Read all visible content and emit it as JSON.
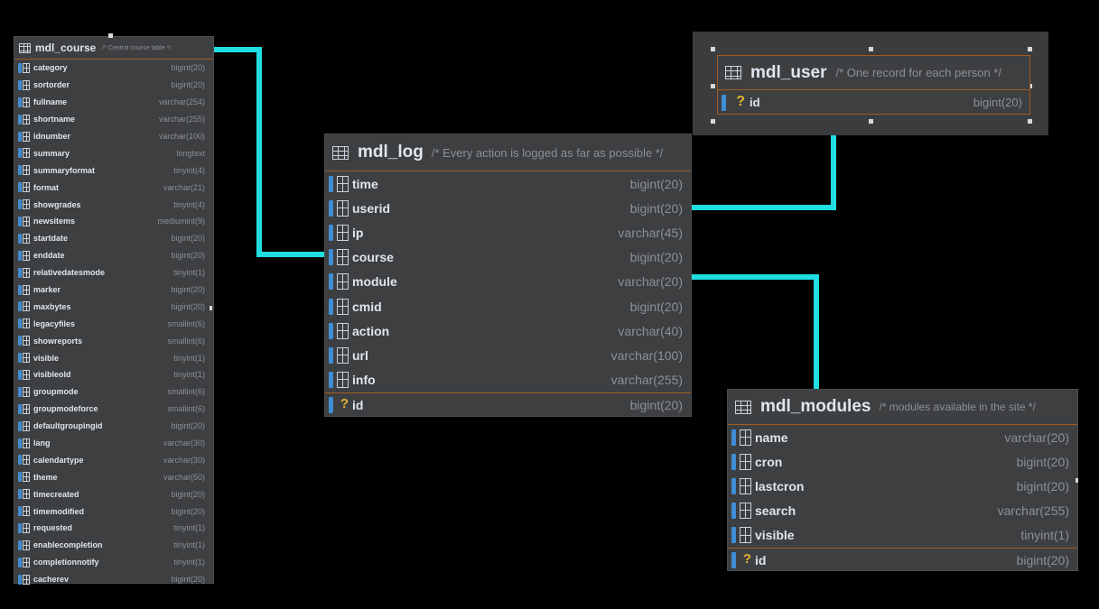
{
  "tables": {
    "course": {
      "name": "mdl_course",
      "comment": "/* Central course table */",
      "columns": [
        {
          "name": "category",
          "type": "bigint(20)"
        },
        {
          "name": "sortorder",
          "type": "bigint(20)"
        },
        {
          "name": "fullname",
          "type": "varchar(254)"
        },
        {
          "name": "shortname",
          "type": "varchar(255)"
        },
        {
          "name": "idnumber",
          "type": "varchar(100)"
        },
        {
          "name": "summary",
          "type": "longtext"
        },
        {
          "name": "summaryformat",
          "type": "tinyint(4)"
        },
        {
          "name": "format",
          "type": "varchar(21)"
        },
        {
          "name": "showgrades",
          "type": "tinyint(4)"
        },
        {
          "name": "newsitems",
          "type": "mediumint(9)"
        },
        {
          "name": "startdate",
          "type": "bigint(20)"
        },
        {
          "name": "enddate",
          "type": "bigint(20)"
        },
        {
          "name": "relativedatesmode",
          "type": "tinyint(1)"
        },
        {
          "name": "marker",
          "type": "bigint(20)"
        },
        {
          "name": "maxbytes",
          "type": "bigint(20)"
        },
        {
          "name": "legacyfiles",
          "type": "smallint(6)"
        },
        {
          "name": "showreports",
          "type": "smallint(6)"
        },
        {
          "name": "visible",
          "type": "tinyint(1)"
        },
        {
          "name": "visibleold",
          "type": "tinyint(1)"
        },
        {
          "name": "groupmode",
          "type": "smallint(6)"
        },
        {
          "name": "groupmodeforce",
          "type": "smallint(6)"
        },
        {
          "name": "defaultgroupingid",
          "type": "bigint(20)"
        },
        {
          "name": "lang",
          "type": "varchar(30)"
        },
        {
          "name": "calendartype",
          "type": "varchar(30)"
        },
        {
          "name": "theme",
          "type": "varchar(50)"
        },
        {
          "name": "timecreated",
          "type": "bigint(20)"
        },
        {
          "name": "timemodified",
          "type": "bigint(20)"
        },
        {
          "name": "requested",
          "type": "tinyint(1)"
        },
        {
          "name": "enablecompletion",
          "type": "tinyint(1)"
        },
        {
          "name": "completionnotify",
          "type": "tinyint(1)"
        },
        {
          "name": "cacherev",
          "type": "bigint(20)"
        }
      ]
    },
    "user": {
      "name": "mdl_user",
      "comment": "/* One record for each person */",
      "pk": {
        "name": "id",
        "type": "bigint(20)"
      }
    },
    "log": {
      "name": "mdl_log",
      "comment": "/* Every action is logged as far as possible */",
      "columns": [
        {
          "name": "time",
          "type": "bigint(20)"
        },
        {
          "name": "userid",
          "type": "bigint(20)"
        },
        {
          "name": "ip",
          "type": "varchar(45)"
        },
        {
          "name": "course",
          "type": "bigint(20)"
        },
        {
          "name": "module",
          "type": "varchar(20)"
        },
        {
          "name": "cmid",
          "type": "bigint(20)"
        },
        {
          "name": "action",
          "type": "varchar(40)"
        },
        {
          "name": "url",
          "type": "varchar(100)"
        },
        {
          "name": "info",
          "type": "varchar(255)"
        }
      ],
      "pk": {
        "name": "id",
        "type": "bigint(20)"
      }
    },
    "modules": {
      "name": "mdl_modules",
      "comment": "/* modules available in the site */",
      "columns": [
        {
          "name": "name",
          "type": "varchar(20)"
        },
        {
          "name": "cron",
          "type": "bigint(20)"
        },
        {
          "name": "lastcron",
          "type": "bigint(20)"
        },
        {
          "name": "search",
          "type": "varchar(255)"
        },
        {
          "name": "visible",
          "type": "tinyint(1)"
        }
      ],
      "pk": {
        "name": "id",
        "type": "bigint(20)"
      }
    }
  },
  "colors": {
    "connector": "#1fdde0",
    "table_bg": "#3d3f41",
    "separator": "#a25c22",
    "key": "#e3b331",
    "column_icon": "#3f8dd4"
  },
  "icons": {
    "table": "table-grid-icon",
    "column": "column-icon",
    "primary_key": "primary-key-icon"
  }
}
